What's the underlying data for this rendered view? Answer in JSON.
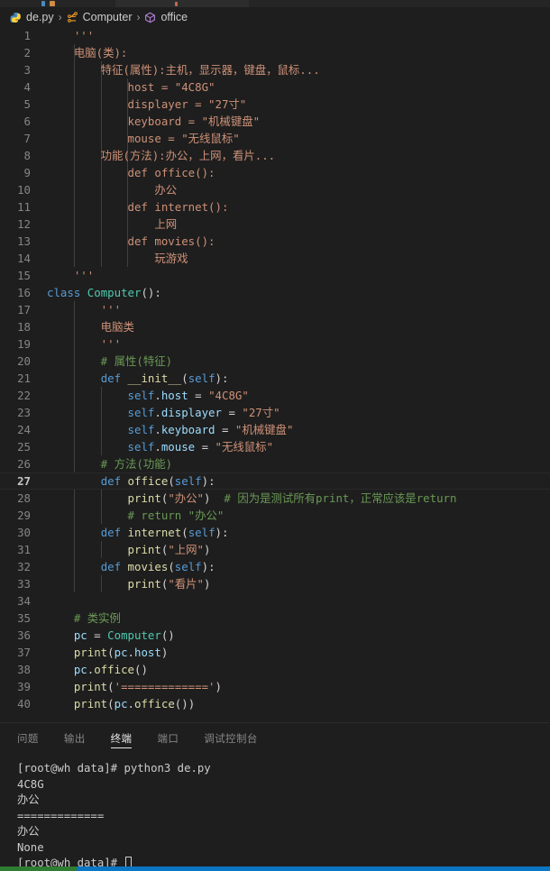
{
  "breadcrumb": {
    "items": [
      {
        "icon": "python-file-icon",
        "label": "de.py"
      },
      {
        "icon": "class-symbol-icon",
        "label": "Computer"
      },
      {
        "icon": "method-symbol-icon",
        "label": "office"
      }
    ],
    "separator": "›"
  },
  "editor": {
    "active_line": 27,
    "lines": [
      {
        "n": 1,
        "tokens": [
          {
            "c": "str",
            "t": "    '''"
          }
        ]
      },
      {
        "n": 2,
        "tokens": [
          {
            "c": "str",
            "t": "    电脑(类):"
          }
        ]
      },
      {
        "n": 3,
        "tokens": [
          {
            "c": "str",
            "t": "        特征(属性):主机，显示器，键盘，鼠标..."
          }
        ]
      },
      {
        "n": 4,
        "tokens": [
          {
            "c": "str",
            "t": "            host = \"4C8G\""
          }
        ]
      },
      {
        "n": 5,
        "tokens": [
          {
            "c": "str",
            "t": "            displayer = \"27寸\""
          }
        ]
      },
      {
        "n": 6,
        "tokens": [
          {
            "c": "str",
            "t": "            keyboard = \"机械键盘\""
          }
        ]
      },
      {
        "n": 7,
        "tokens": [
          {
            "c": "str",
            "t": "            mouse = \"无线鼠标\""
          }
        ]
      },
      {
        "n": 8,
        "tokens": [
          {
            "c": "str",
            "t": "        功能(方法):办公，上网，看片..."
          }
        ]
      },
      {
        "n": 9,
        "tokens": [
          {
            "c": "str",
            "t": "            def office():"
          }
        ]
      },
      {
        "n": 10,
        "tokens": [
          {
            "c": "str",
            "t": "                办公"
          }
        ]
      },
      {
        "n": 11,
        "tokens": [
          {
            "c": "str",
            "t": "            def internet():"
          }
        ]
      },
      {
        "n": 12,
        "tokens": [
          {
            "c": "str",
            "t": "                上网"
          }
        ]
      },
      {
        "n": 13,
        "tokens": [
          {
            "c": "str",
            "t": "            def movies():"
          }
        ]
      },
      {
        "n": 14,
        "tokens": [
          {
            "c": "str",
            "t": "                玩游戏"
          }
        ]
      },
      {
        "n": 15,
        "tokens": [
          {
            "c": "str",
            "t": "    '''"
          }
        ]
      },
      {
        "n": 16,
        "tokens": [
          {
            "c": "kw",
            "t": "class"
          },
          {
            "c": "pun",
            "t": " "
          },
          {
            "c": "cls",
            "t": "Computer"
          },
          {
            "c": "pun",
            "t": "():"
          }
        ]
      },
      {
        "n": 17,
        "tokens": [
          {
            "c": "str",
            "t": "        '''"
          }
        ]
      },
      {
        "n": 18,
        "tokens": [
          {
            "c": "str",
            "t": "        电脑类"
          }
        ]
      },
      {
        "n": 19,
        "tokens": [
          {
            "c": "str",
            "t": "        '''"
          }
        ]
      },
      {
        "n": 20,
        "tokens": [
          {
            "c": "com",
            "t": "        # 属性(特征)"
          }
        ]
      },
      {
        "n": 21,
        "tokens": [
          {
            "c": "pun",
            "t": "        "
          },
          {
            "c": "kw",
            "t": "def"
          },
          {
            "c": "pun",
            "t": " "
          },
          {
            "c": "fn",
            "t": "__init__"
          },
          {
            "c": "pun",
            "t": "("
          },
          {
            "c": "self",
            "t": "self"
          },
          {
            "c": "pun",
            "t": "):"
          }
        ]
      },
      {
        "n": 22,
        "tokens": [
          {
            "c": "pun",
            "t": "            "
          },
          {
            "c": "self",
            "t": "self"
          },
          {
            "c": "pun",
            "t": "."
          },
          {
            "c": "var",
            "t": "host"
          },
          {
            "c": "pun",
            "t": " = "
          },
          {
            "c": "str",
            "t": "\"4C8G\""
          }
        ]
      },
      {
        "n": 23,
        "tokens": [
          {
            "c": "pun",
            "t": "            "
          },
          {
            "c": "self",
            "t": "self"
          },
          {
            "c": "pun",
            "t": "."
          },
          {
            "c": "var",
            "t": "displayer"
          },
          {
            "c": "pun",
            "t": " = "
          },
          {
            "c": "str",
            "t": "\"27寸\""
          }
        ]
      },
      {
        "n": 24,
        "tokens": [
          {
            "c": "pun",
            "t": "            "
          },
          {
            "c": "self",
            "t": "self"
          },
          {
            "c": "pun",
            "t": "."
          },
          {
            "c": "var",
            "t": "keyboard"
          },
          {
            "c": "pun",
            "t": " = "
          },
          {
            "c": "str",
            "t": "\"机械键盘\""
          }
        ]
      },
      {
        "n": 25,
        "tokens": [
          {
            "c": "pun",
            "t": "            "
          },
          {
            "c": "self",
            "t": "self"
          },
          {
            "c": "pun",
            "t": "."
          },
          {
            "c": "var",
            "t": "mouse"
          },
          {
            "c": "pun",
            "t": " = "
          },
          {
            "c": "str",
            "t": "\"无线鼠标\""
          }
        ]
      },
      {
        "n": 26,
        "tokens": [
          {
            "c": "com",
            "t": "        # 方法(功能)"
          }
        ]
      },
      {
        "n": 27,
        "tokens": [
          {
            "c": "pun",
            "t": "        "
          },
          {
            "c": "kw",
            "t": "def"
          },
          {
            "c": "pun",
            "t": " "
          },
          {
            "c": "fn",
            "t": "office"
          },
          {
            "c": "pun",
            "t": "("
          },
          {
            "c": "self",
            "t": "self"
          },
          {
            "c": "pun",
            "t": "):"
          }
        ]
      },
      {
        "n": 28,
        "tokens": [
          {
            "c": "pun",
            "t": "            "
          },
          {
            "c": "fn",
            "t": "print"
          },
          {
            "c": "pun",
            "t": "("
          },
          {
            "c": "str",
            "t": "\"办公\""
          },
          {
            "c": "pun",
            "t": ")  "
          },
          {
            "c": "com",
            "t": "# 因为是测试所有print，正常应该是return"
          }
        ]
      },
      {
        "n": 29,
        "tokens": [
          {
            "c": "com",
            "t": "            # return \"办公\""
          }
        ]
      },
      {
        "n": 30,
        "tokens": [
          {
            "c": "pun",
            "t": "        "
          },
          {
            "c": "kw",
            "t": "def"
          },
          {
            "c": "pun",
            "t": " "
          },
          {
            "c": "fn",
            "t": "internet"
          },
          {
            "c": "pun",
            "t": "("
          },
          {
            "c": "self",
            "t": "self"
          },
          {
            "c": "pun",
            "t": "):"
          }
        ]
      },
      {
        "n": 31,
        "tokens": [
          {
            "c": "pun",
            "t": "            "
          },
          {
            "c": "fn",
            "t": "print"
          },
          {
            "c": "pun",
            "t": "("
          },
          {
            "c": "str",
            "t": "\"上网\""
          },
          {
            "c": "pun",
            "t": ")"
          }
        ]
      },
      {
        "n": 32,
        "tokens": [
          {
            "c": "pun",
            "t": "        "
          },
          {
            "c": "kw",
            "t": "def"
          },
          {
            "c": "pun",
            "t": " "
          },
          {
            "c": "fn",
            "t": "movies"
          },
          {
            "c": "pun",
            "t": "("
          },
          {
            "c": "self",
            "t": "self"
          },
          {
            "c": "pun",
            "t": "):"
          }
        ]
      },
      {
        "n": 33,
        "tokens": [
          {
            "c": "pun",
            "t": "            "
          },
          {
            "c": "fn",
            "t": "print"
          },
          {
            "c": "pun",
            "t": "("
          },
          {
            "c": "str",
            "t": "\"看片\""
          },
          {
            "c": "pun",
            "t": ")"
          }
        ]
      },
      {
        "n": 34,
        "tokens": [
          {
            "c": "pun",
            "t": ""
          }
        ]
      },
      {
        "n": 35,
        "tokens": [
          {
            "c": "com",
            "t": "    # 类实例"
          }
        ]
      },
      {
        "n": 36,
        "tokens": [
          {
            "c": "pun",
            "t": "    "
          },
          {
            "c": "var",
            "t": "pc"
          },
          {
            "c": "pun",
            "t": " = "
          },
          {
            "c": "cls",
            "t": "Computer"
          },
          {
            "c": "pun",
            "t": "()"
          }
        ]
      },
      {
        "n": 37,
        "tokens": [
          {
            "c": "pun",
            "t": "    "
          },
          {
            "c": "fn",
            "t": "print"
          },
          {
            "c": "pun",
            "t": "("
          },
          {
            "c": "var",
            "t": "pc"
          },
          {
            "c": "pun",
            "t": "."
          },
          {
            "c": "var",
            "t": "host"
          },
          {
            "c": "pun",
            "t": ")"
          }
        ]
      },
      {
        "n": 38,
        "tokens": [
          {
            "c": "pun",
            "t": "    "
          },
          {
            "c": "var",
            "t": "pc"
          },
          {
            "c": "pun",
            "t": "."
          },
          {
            "c": "fn",
            "t": "office"
          },
          {
            "c": "pun",
            "t": "()"
          }
        ]
      },
      {
        "n": 39,
        "tokens": [
          {
            "c": "pun",
            "t": "    "
          },
          {
            "c": "fn",
            "t": "print"
          },
          {
            "c": "pun",
            "t": "("
          },
          {
            "c": "str",
            "t": "'============='"
          },
          {
            "c": "pun",
            "t": ")"
          }
        ]
      },
      {
        "n": 40,
        "tokens": [
          {
            "c": "pun",
            "t": "    "
          },
          {
            "c": "fn",
            "t": "print"
          },
          {
            "c": "pun",
            "t": "("
          },
          {
            "c": "var",
            "t": "pc"
          },
          {
            "c": "pun",
            "t": "."
          },
          {
            "c": "fn",
            "t": "office"
          },
          {
            "c": "pun",
            "t": "())"
          }
        ]
      }
    ]
  },
  "panel": {
    "tabs": [
      {
        "label": "问题",
        "active": false
      },
      {
        "label": "输出",
        "active": false
      },
      {
        "label": "终端",
        "active": true
      },
      {
        "label": "端口",
        "active": false
      },
      {
        "label": "调试控制台",
        "active": false
      }
    ],
    "terminal": {
      "lines": [
        "[root@wh data]# python3 de.py",
        "4C8G",
        "办公",
        "=============",
        "办公",
        "None"
      ],
      "prompt": "[root@wh data]# "
    }
  },
  "colors": {
    "background": "#1e1e1e",
    "string": "#ce9178",
    "keyword": "#569cd6",
    "class": "#4ec9b0",
    "function": "#dcdcaa",
    "comment": "#6a9955",
    "variable": "#9cdcfe",
    "linenumber": "#858585",
    "status_green": "#2f7d32",
    "status_blue": "#0a76c4"
  }
}
